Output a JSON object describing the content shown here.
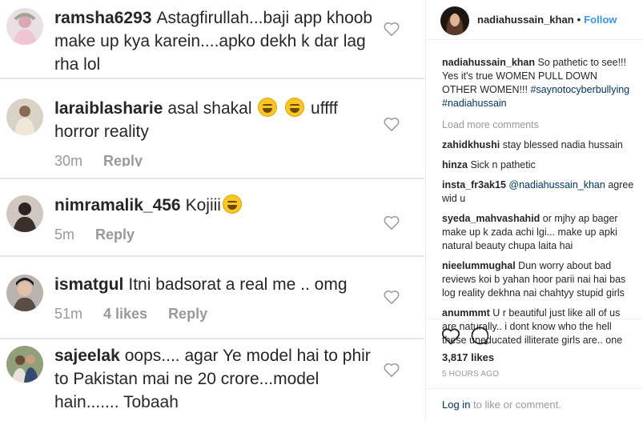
{
  "zoomed_comments": [
    {
      "user": "ramsha6293",
      "text": "Astagfirullah...baji app khoob make up kya karein....apko dekh k dar lag rha lol",
      "time": "",
      "likes": "",
      "reply": ""
    },
    {
      "user": "laraiblasharie",
      "text": "asal shakal",
      "text_after": "uffff horror reality",
      "time": "30m",
      "likes": "",
      "reply": "Reply"
    },
    {
      "user": "nimramalik_456",
      "text": "Kojiii",
      "time": "5m",
      "likes": "",
      "reply": "Reply"
    },
    {
      "user": "ismatgul",
      "text": "Itni badsorat a real me .. omg",
      "time": "51m",
      "likes": "4 likes",
      "reply": "Reply"
    },
    {
      "user": "sajeelak",
      "text": "oops.... agar Ye model hai to phir to Pakistan mai ne 20 crore...model hain....... Tobaah",
      "time": "",
      "likes": "",
      "reply": ""
    }
  ],
  "header": {
    "username": "nadiahussain_khan",
    "separator": "•",
    "follow_label": "Follow"
  },
  "caption": {
    "user": "nadiahussain_khan",
    "text": "So pathetic to see!!! Yes it's true WOMEN PULL DOWN OTHER WOMEN!!!",
    "hashtags": [
      "#saynotocyberbullying",
      "#nadiahussain"
    ]
  },
  "load_more_label": "Load more comments",
  "comments": [
    {
      "user": "zahidkhushi",
      "text": "stay blessed nadia hussain"
    },
    {
      "user": "hinza",
      "text": "Sick n pathetic"
    },
    {
      "user": "insta_fr3ak15",
      "mention": "@nadiahussain_khan",
      "text": "agree wid u"
    },
    {
      "user": "syeda_mahvashahid",
      "text": "or mjhy ap bager make up k zada achi lgi... make up apki natural beauty chupa laita hai"
    },
    {
      "user": "nieelummughal",
      "text": "Dun worry about bad reviews koi b yahan hoor parii nai hai bas log reality dekhna nai chahtyy stupid girls"
    },
    {
      "user": "anummmt",
      "text": "U r beautiful just like all of us are naturally.. i dont know who the hell these uneducated illiterate girls are.. one"
    }
  ],
  "likes_count": "3,817 likes",
  "time_ago": "5 HOURS AGO",
  "login": {
    "link": "Log in",
    "rest": "to like or comment."
  },
  "icons": {
    "like": "heart-icon",
    "comment": "comment-bubble-icon"
  },
  "colors": {
    "link": "#003569",
    "follow": "#3897f0",
    "muted": "#999999",
    "text": "#262626"
  }
}
